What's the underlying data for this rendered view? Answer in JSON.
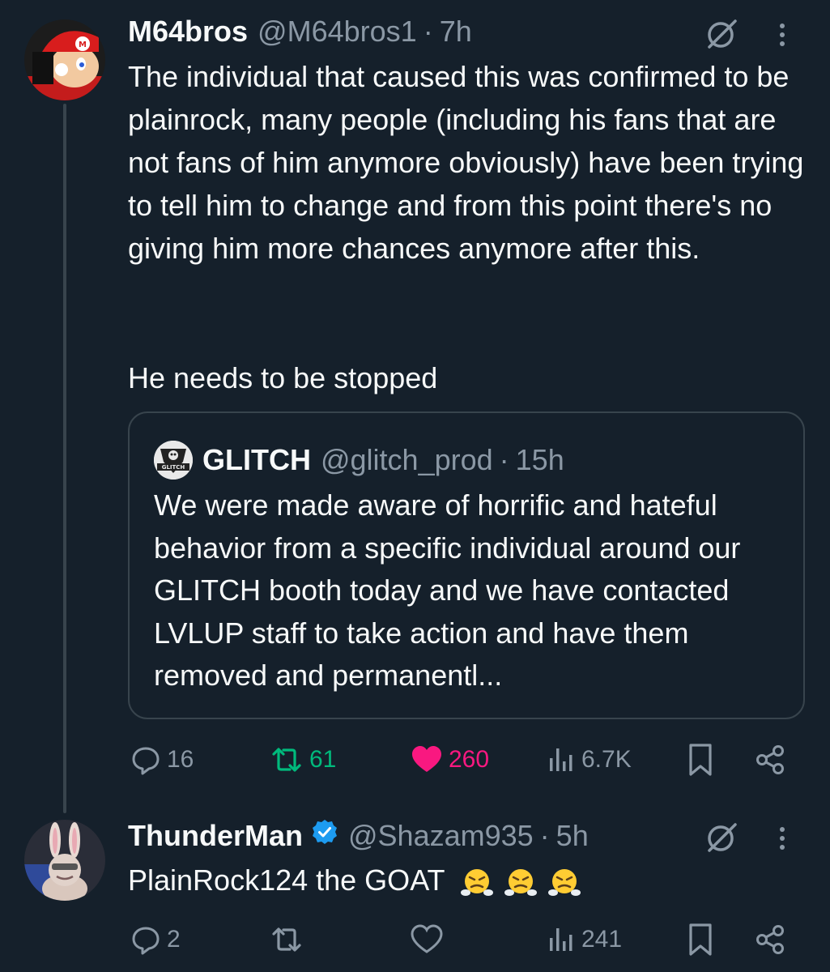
{
  "colors": {
    "background": "#15202b",
    "primary_text": "#f7f9f9",
    "secondary_text": "#8b98a5",
    "border": "#38444d",
    "retweet_green": "#00ba7c",
    "like_pink": "#f91880",
    "verified_blue": "#1d9bf0"
  },
  "tweet1": {
    "name": "M64bros",
    "handle": "@M64bros1",
    "separator": "·",
    "time": "7h",
    "paragraph1": "The individual that caused this was confirmed to be plainrock, many people (including his fans that are not fans of him anymore obviously) have been trying to tell him to change and from this point there's no giving him more chances anymore after this.",
    "paragraph2": "He needs to be stopped",
    "quote": {
      "logo_text": "GLITCH",
      "name": "GLITCH",
      "handle": "@glitch_prod",
      "separator": "·",
      "time": "15h",
      "text": "We were made aware of horrific and hateful behavior from a specific individual around our GLITCH booth today and we have contacted LVLUP staff to take action and have them removed and permanentl..."
    },
    "actions": {
      "replies": "16",
      "retweets": "61",
      "likes": "260",
      "views": "6.7K",
      "retweeted": true,
      "liked": true
    }
  },
  "tweet2": {
    "name": "ThunderMan",
    "verified": true,
    "handle": "@Shazam935",
    "separator": "·",
    "time": "5h",
    "text": "PlainRock124 the GOAT",
    "emojis": [
      "face-with-steam-from-nose",
      "face-with-steam-from-nose",
      "face-with-steam-from-nose"
    ],
    "actions": {
      "replies": "2",
      "views": "241"
    }
  }
}
